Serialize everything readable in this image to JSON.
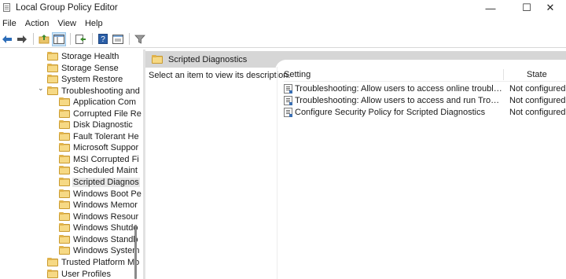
{
  "window": {
    "title": "Local Group Policy Editor",
    "minimize_glyph": "—",
    "maximize_glyph": "☐",
    "close_glyph": "✕"
  },
  "menu": [
    "File",
    "Action",
    "View",
    "Help"
  ],
  "toolbar": {
    "icons": [
      "back-icon",
      "forward-icon",
      "up-folder-icon",
      "show-hide-tree-icon",
      "export-list-icon",
      "help-icon",
      "properties-icon",
      "filter-icon"
    ]
  },
  "tree": {
    "items": [
      {
        "label": "Storage Health"
      },
      {
        "label": "Storage Sense"
      },
      {
        "label": "System Restore"
      },
      {
        "label": "Troubleshooting and"
      },
      {
        "label": "Application Com"
      },
      {
        "label": "Corrupted File Re"
      },
      {
        "label": "Disk Diagnostic"
      },
      {
        "label": "Fault Tolerant He"
      },
      {
        "label": "Microsoft Suppor"
      },
      {
        "label": "MSI Corrupted Fi"
      },
      {
        "label": "Scheduled Maint"
      },
      {
        "label": "Scripted Diagnos"
      },
      {
        "label": "Windows Boot Pe"
      },
      {
        "label": "Windows Memor"
      },
      {
        "label": "Windows Resour"
      },
      {
        "label": "Windows Shutdo"
      },
      {
        "label": "Windows Standb"
      },
      {
        "label": "Windows System"
      },
      {
        "label": "Trusted Platform Mo"
      },
      {
        "label": "User Profiles"
      }
    ],
    "expanded_glyph": "⌄"
  },
  "details": {
    "header_title": "Scripted Diagnostics",
    "description_hint": "Select an item to view its description.",
    "columns": {
      "setting": "Setting",
      "state": "State"
    },
    "rows": [
      {
        "setting": "Troubleshooting: Allow users to access online troubleshooti...",
        "state": "Not configured"
      },
      {
        "setting": "Troubleshooting: Allow users to access and run Troubleshoo...",
        "state": "Not configured"
      },
      {
        "setting": "Configure Security Policy for Scripted Diagnostics",
        "state": "Not configured"
      }
    ]
  },
  "colors": {
    "header_band": "#d6d6d6",
    "folder": "#e9c46a",
    "selection": "#e6e6e6",
    "toolbar_selected": "#cde4f7"
  }
}
